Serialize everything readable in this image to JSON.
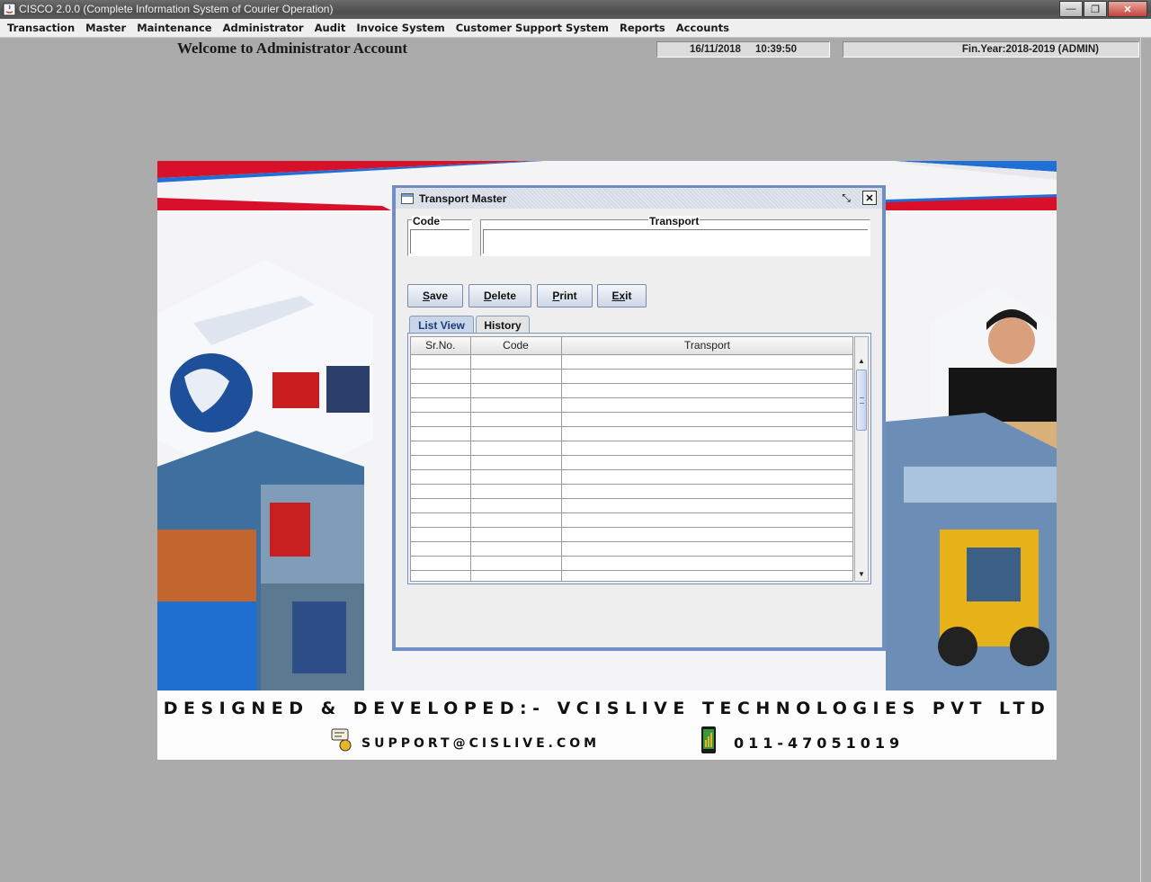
{
  "window": {
    "title": "CISCO 2.0.0 (Complete Information System of Courier Operation)",
    "minimize_label": "—",
    "restore_label": "❐",
    "close_label": "✕"
  },
  "menubar": {
    "items": [
      "Transaction",
      "Master",
      "Maintenance",
      "Administrator",
      "Audit",
      "Invoice System",
      "Customer Support System",
      "Reports",
      "Accounts"
    ]
  },
  "header": {
    "welcome": "Welcome to Administrator Account",
    "date": "16/11/2018",
    "time": "10:39:50",
    "fin_year": "Fin.Year:2018-2019  (ADMIN)"
  },
  "banner": {
    "credit": "DESIGNED & DEVELOPED:- VCISLIVE TECHNOLOGIES PVT LTD",
    "support_email": "SUPPORT@CISLIVE.COM",
    "phone": "011-47051019"
  },
  "transport_master": {
    "title": "Transport Master",
    "restore_label": "⤡",
    "close_label": "✕",
    "code_label": "Code",
    "code_value": "",
    "transport_label": "Transport",
    "transport_value": "",
    "buttons": {
      "save": {
        "mnemonic": "S",
        "rest": "ave"
      },
      "delete": {
        "mnemonic": "D",
        "rest": "elete"
      },
      "print": {
        "mnemonic": "P",
        "rest": "rint"
      },
      "exit": {
        "pre": "E",
        "mnemonic": "x",
        "rest": "it"
      }
    },
    "tabs": [
      "List View",
      "History"
    ],
    "table": {
      "columns": [
        "Sr.No.",
        "Code",
        "Transport"
      ],
      "rows": []
    }
  },
  "colors": {
    "frame_border": "#6f8fc4",
    "tab_active_text": "#1b3a78",
    "desktop_bg": "#ababab"
  }
}
